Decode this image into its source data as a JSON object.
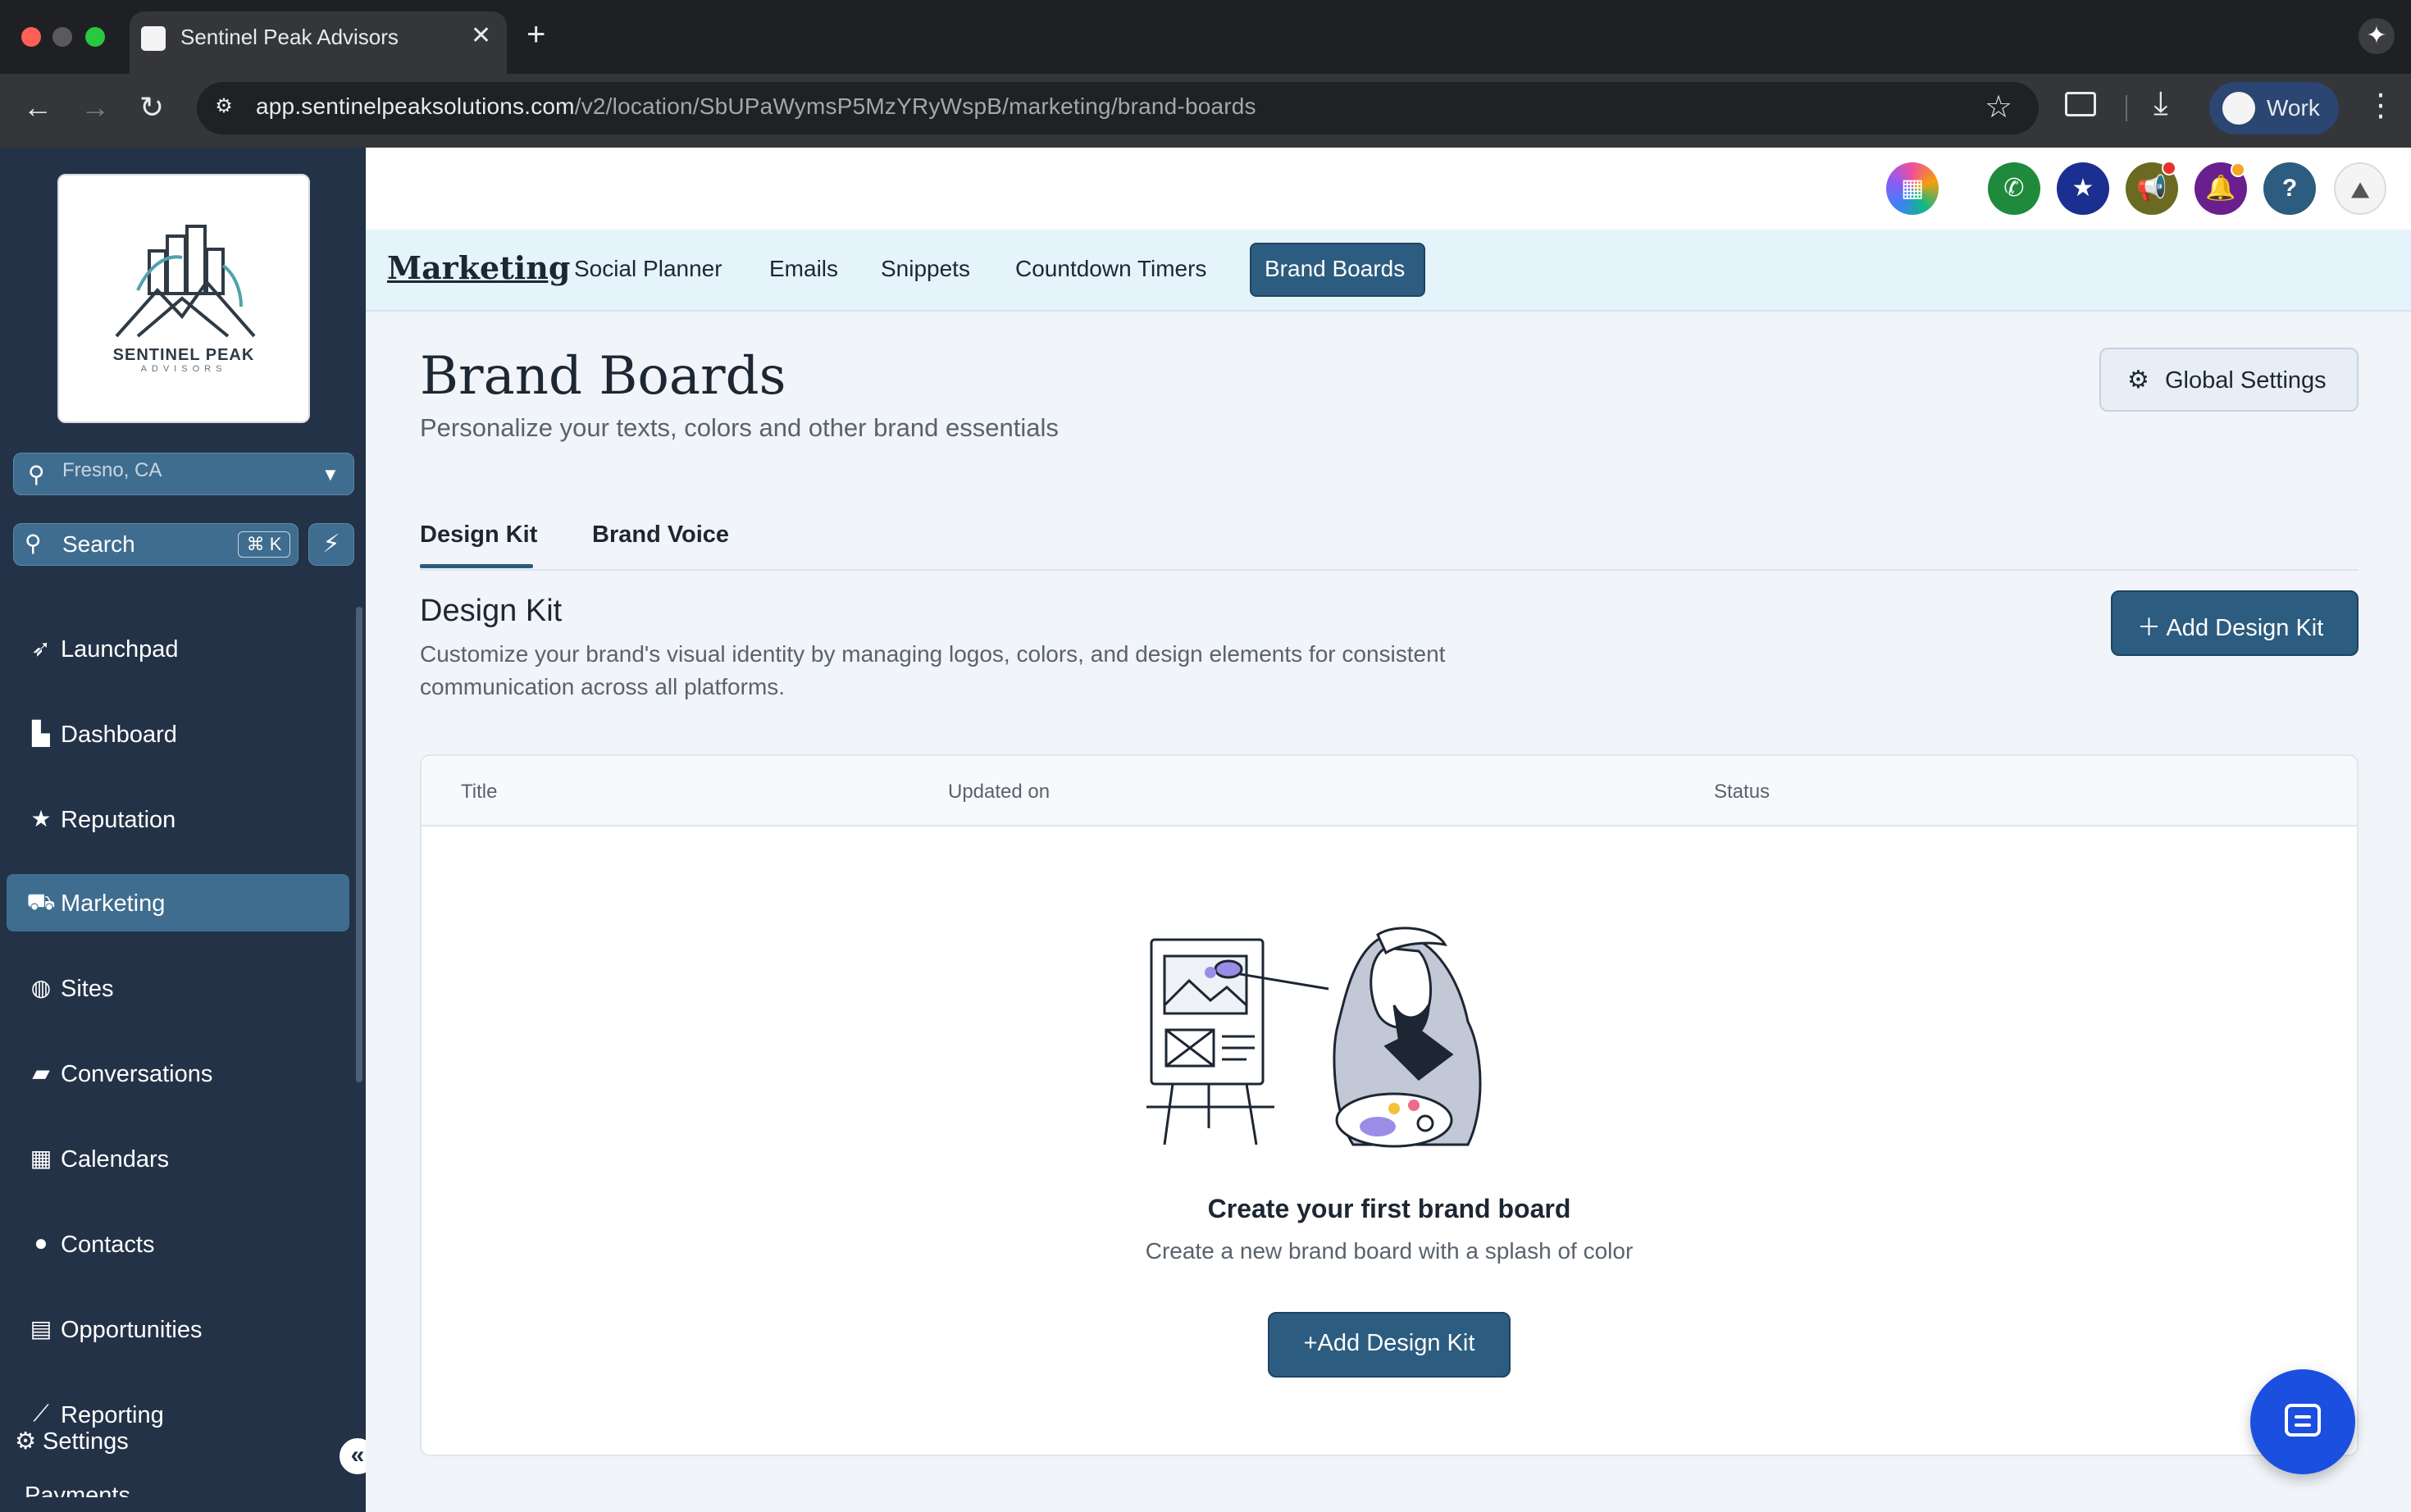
{
  "browser": {
    "tab_title": "Sentinel Peak Advisors",
    "tab_close": "✕",
    "new_tab": "+",
    "url_host": "app.sentinelpeaksolutions.com",
    "url_path": "/v2/location/SbUPaWymsP5MzYRyWspB/marketing/brand-boards",
    "profile_label": "Work",
    "icons": [
      "back-icon",
      "forward-icon",
      "reload-icon",
      "site-info-icon",
      "bookmark-star-icon",
      "cast-icon",
      "download-icon",
      "menu-kebab-icon",
      "gemini-spark-icon"
    ]
  },
  "sidebar": {
    "logo_title": "SENTINEL PEAK",
    "logo_sub": "ADVISORS",
    "location": "Fresno, CA",
    "search_label": "Search",
    "search_shortcut": "⌘ K",
    "items": [
      {
        "label": "Launchpad",
        "icon": "rocket-icon"
      },
      {
        "label": "Dashboard",
        "icon": "chart-icon"
      },
      {
        "label": "Reputation",
        "icon": "star-icon"
      },
      {
        "label": "Marketing",
        "icon": "cart-icon",
        "active": true
      },
      {
        "label": "Sites",
        "icon": "globe-icon"
      },
      {
        "label": "Conversations",
        "icon": "chat-icon"
      },
      {
        "label": "Calendars",
        "icon": "calendar-icon"
      },
      {
        "label": "Contacts",
        "icon": "contacts-icon"
      },
      {
        "label": "Opportunities",
        "icon": "opportunities-icon"
      },
      {
        "label": "Reporting",
        "icon": "reporting-icon"
      }
    ],
    "settings_label": "Settings",
    "payments_label": "Payments"
  },
  "subnav": {
    "title": "Marketing",
    "items": [
      "Social Planner",
      "Emails",
      "Snippets",
      "Countdown Timers"
    ],
    "active": "Brand Boards"
  },
  "page": {
    "title": "Brand Boards",
    "subtitle": "Personalize your texts, colors and other brand essentials",
    "global_settings": "Global Settings",
    "tabs": [
      "Design Kit",
      "Brand Voice"
    ],
    "section_title": "Design Kit",
    "section_desc": "Customize your brand's visual identity by managing logos, colors, and design elements for consistent communication across all platforms.",
    "add_design_kit": "Add Design Kit",
    "table_headers": [
      "Title",
      "Updated on",
      "Status"
    ],
    "empty_title": "Create your first brand board",
    "empty_sub": "Create a new brand board with a splash of color",
    "empty_button": "Add Design Kit"
  },
  "colors": {
    "sidebar_bg": "#233247",
    "primary": "#2c5c7f",
    "subnav_bg": "#e5f3fb",
    "chat_fab": "#1a4fe0"
  }
}
